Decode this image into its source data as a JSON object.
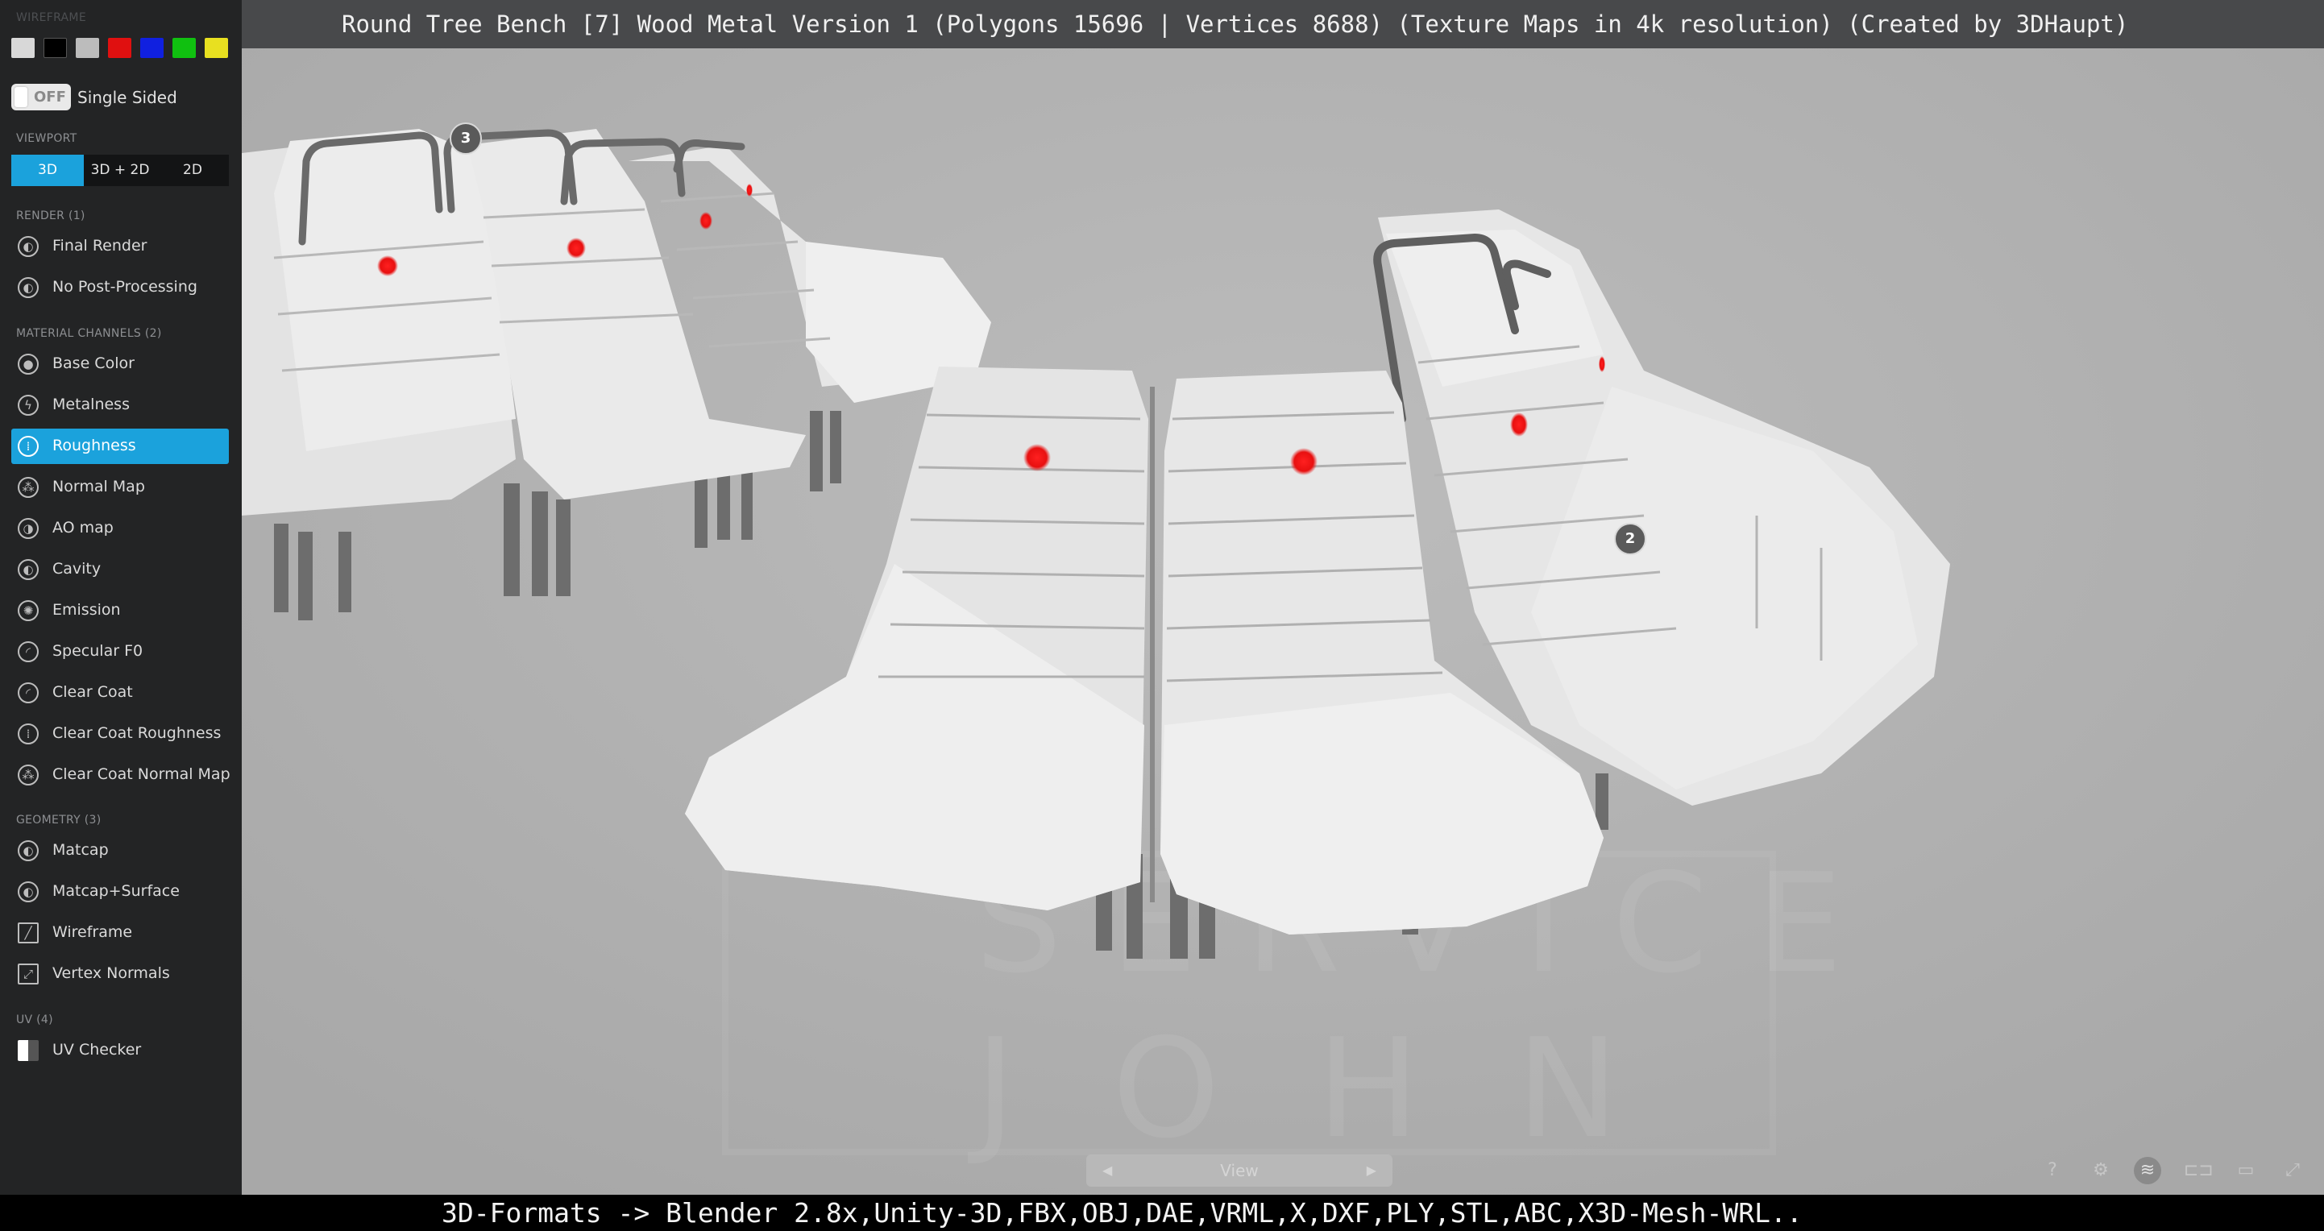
{
  "title": "Round Tree Bench [7] Wood Metal Version 1 (Polygons 15696 | Vertices 8688) (Texture Maps in 4k resolution) (Created by 3DHaupt)",
  "bottom_banner": "3D-Formats -> Blender 2.8x,Unity-3D,FBX,OBJ,DAE,VRML,X,DXF,PLY,STL,ABC,X3D-Mesh-WRL..",
  "sidebar": {
    "wireframe_title": "WIREFRAME",
    "wireframe_colors": [
      "#d8d8d8",
      "#000000",
      "#bcbcbc",
      "#e01010",
      "#1020e0",
      "#10c010",
      "#e8e020"
    ],
    "single_sided": {
      "state": "OFF",
      "label": "Single Sided"
    },
    "viewport_title": "VIEWPORT",
    "viewport_modes": [
      "3D",
      "3D + 2D",
      "2D"
    ],
    "viewport_active": "3D",
    "render_title": "RENDER (1)",
    "render_items": [
      "Final Render",
      "No Post-Processing"
    ],
    "material_title": "MATERIAL CHANNELS (2)",
    "material_items": [
      "Base Color",
      "Metalness",
      "Roughness",
      "Normal Map",
      "AO map",
      "Cavity",
      "Emission",
      "Specular F0",
      "Clear Coat",
      "Clear Coat Roughness",
      "Clear Coat Normal Map"
    ],
    "material_active": "Roughness",
    "geometry_title": "GEOMETRY (3)",
    "geometry_items": [
      "Matcap",
      "Matcap+Surface",
      "Wireframe",
      "Vertex Normals"
    ],
    "uv_title": "UV (4)",
    "uv_items": [
      "UV Checker"
    ]
  },
  "viewport": {
    "hotspots": [
      "3",
      "2"
    ],
    "watermark_lines": [
      "SERVICE",
      "JOHN"
    ],
    "nav_label": "View"
  },
  "colors": {
    "accent": "#1ba2dc",
    "sidebar_bg": "#232425",
    "viewport_bg": "#b2b2b2",
    "annotation_dot": "#ee1111"
  }
}
